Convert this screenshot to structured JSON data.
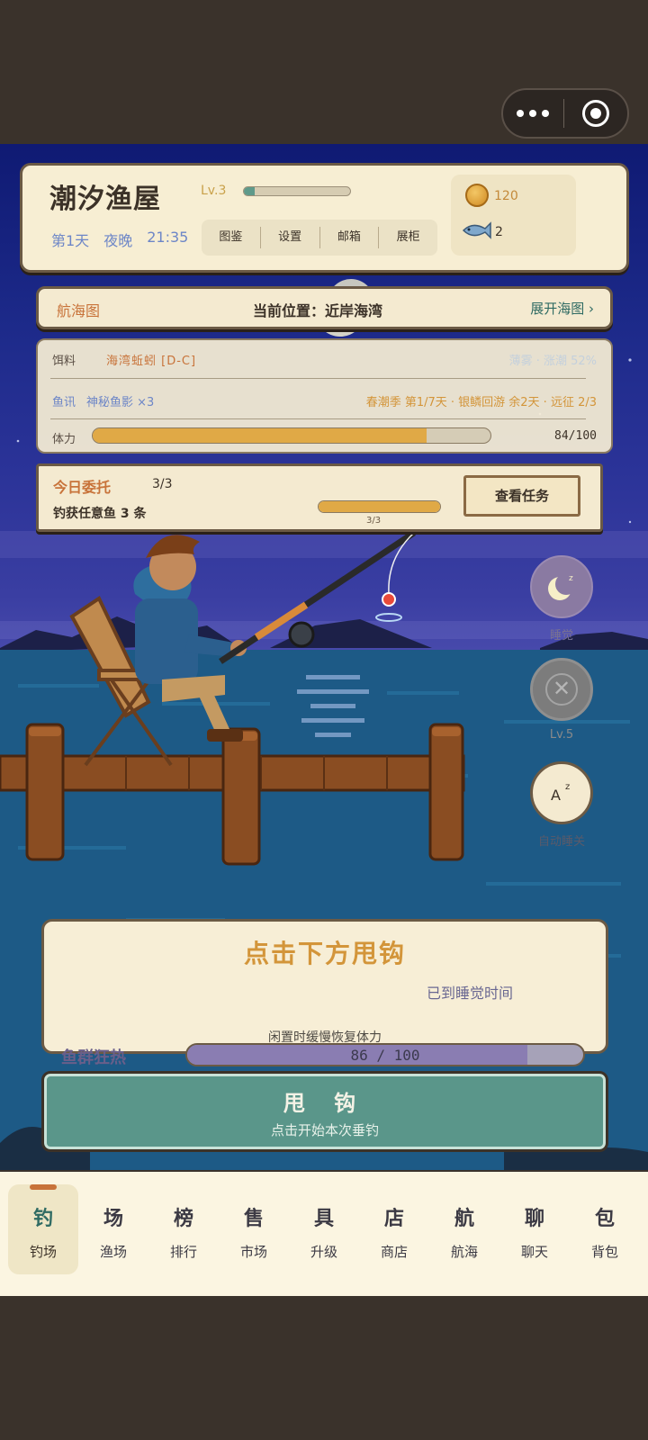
{
  "header": {
    "title": "潮汐渔屋",
    "level": "Lv.3",
    "xp_fraction": 0.1,
    "day": "第1天",
    "period": "夜晚",
    "time": "21:35",
    "menu": [
      "图鉴",
      "设置",
      "邮箱",
      "展柜"
    ],
    "coins": "120",
    "fish_count": "2"
  },
  "chart_bar": {
    "label": "航海图",
    "location": "当前位置：近岸海湾",
    "expand": "展开海图"
  },
  "info": {
    "bait_key": "饵料",
    "bait_value": "海湾蚯蚓 [D-C]",
    "weather": "薄雾 · 涨潮 52%",
    "news_key": "鱼讯",
    "news_value": "神秘鱼影 ×3",
    "season": "春潮季 第1/7天 · 银鳞回游 余2天 · 远征 2/3",
    "stamina_key": "体力",
    "stamina_value": "84/100",
    "stamina_fraction": 0.84
  },
  "task": {
    "title": "今日委托",
    "count": "3/3",
    "desc": "钓获任意鱼 3 条",
    "progress_label": "3/3",
    "progress_fraction": 1.0,
    "button": "查看任务"
  },
  "side_buttons": {
    "sleep": "睡觉",
    "locked": "Lv.5",
    "auto_sleep": "自动睡关"
  },
  "cast": {
    "hint": "点击下方甩钩",
    "sleep_notice": "已到睡觉时间",
    "recover": "闲置时缓慢恢复体力",
    "frenzy_label": "鱼群狂热",
    "frenzy_value": "86 / 100",
    "frenzy_fraction": 0.86,
    "button_main": "甩 钩",
    "button_sub": "点击开始本次垂钓"
  },
  "nav": [
    {
      "glyph": "钓",
      "label": "钓场",
      "active": true
    },
    {
      "glyph": "场",
      "label": "渔场"
    },
    {
      "glyph": "榜",
      "label": "排行"
    },
    {
      "glyph": "售",
      "label": "市场"
    },
    {
      "glyph": "具",
      "label": "升级"
    },
    {
      "glyph": "店",
      "label": "商店"
    },
    {
      "glyph": "航",
      "label": "航海"
    },
    {
      "glyph": "聊",
      "label": "聊天"
    },
    {
      "glyph": "包",
      "label": "背包"
    }
  ],
  "colors": {
    "accent": "#2f6b63",
    "orange": "#c8733a",
    "gold": "#d3953a",
    "panel": "#f7eed3",
    "cast_button": "#5a968a"
  },
  "icons": [
    "more-icon",
    "target-icon",
    "coin-icon",
    "fish-icon",
    "moon-icon",
    "close-icon",
    "sleep-az-icon",
    "chevron-right-icon"
  ]
}
